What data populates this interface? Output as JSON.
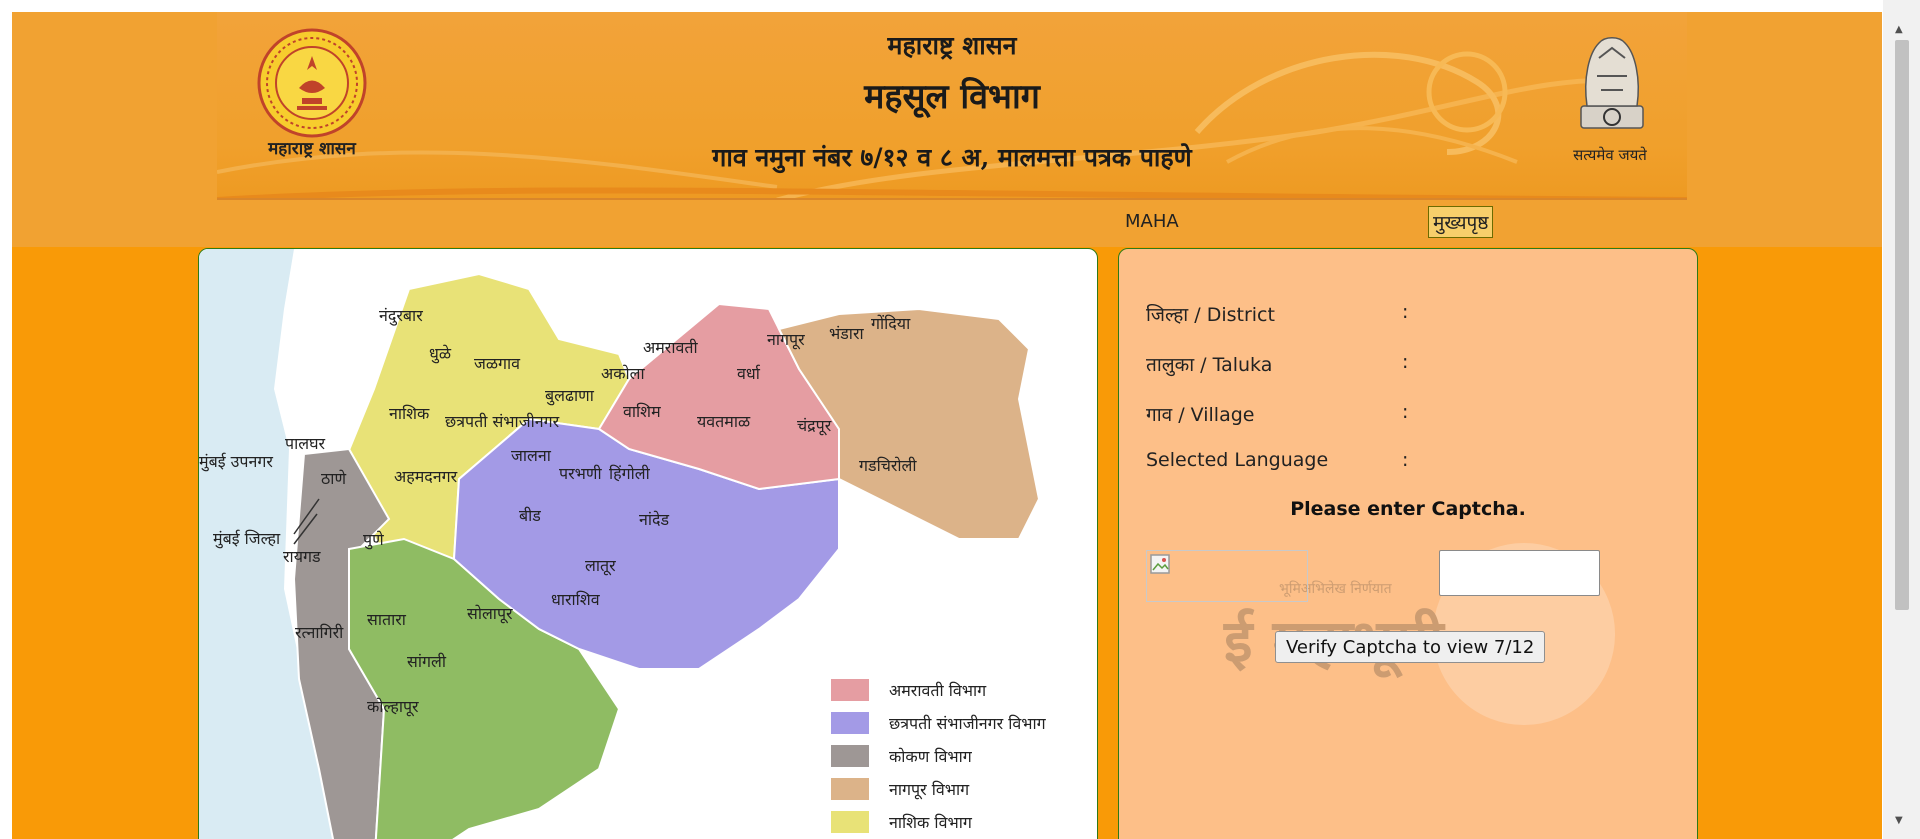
{
  "header": {
    "gov_title": "महाराष्ट्र शासन",
    "department_title": "महसूल विभाग",
    "subtitle": "गाव नमुना नंबर ७/१२ व ८ अ, मालमत्ता पत्रक पाहणे",
    "left_emblem_label": "महाराष्ट्र शासन",
    "right_emblem_label": "सत्यमेव जयते"
  },
  "nav": {
    "maha_link": "MAHA",
    "home_link": "मुख्यपृष्ठ"
  },
  "map": {
    "district_labels": [
      "नंदुरबार",
      "धुळे",
      "जळगाव",
      "नाशिक",
      "पालघर",
      "मुंबई उपनगर",
      "ठाणे",
      "मुंबई जिल्हा",
      "रायगड",
      "रत्नागिरी",
      "अहमदनगर",
      "पुणे",
      "सातारा",
      "सांगली",
      "कोल्हापूर",
      "सोलापूर",
      "छत्रपती संभाजीनगर",
      "जालना",
      "बीड",
      "परभणी",
      "हिंगोली",
      "नांदेड",
      "लातूर",
      "धाराशिव",
      "बुलढाणा",
      "अकोला",
      "अमरावती",
      "वाशिम",
      "यवतमाळ",
      "वर्धा",
      "नागपूर",
      "भंडारा",
      "गोंदिया",
      "चंद्रपूर",
      "गडचिरोली"
    ],
    "legend": [
      {
        "label": "अमरावती विभाग",
        "color": "#e59da2"
      },
      {
        "label": "छत्रपती संभाजीनगर विभाग",
        "color": "#a39ae6"
      },
      {
        "label": "कोकण विभाग",
        "color": "#9e9795"
      },
      {
        "label": "नागपूर विभाग",
        "color": "#dcb389"
      },
      {
        "label": "नाशिक विभाग",
        "color": "#e8e277"
      }
    ],
    "pune_division_color": "#8fbc63",
    "sea_color": "#d9ebf3"
  },
  "form": {
    "district_label": "जिल्हा / District",
    "taluka_label": "तालुका / Taluka",
    "village_label": "गाव / Village",
    "language_label": "Selected Language",
    "colon": ":",
    "captcha_prompt": "Please enter Captcha.",
    "captcha_input_value": "",
    "verify_button": "Verify Captcha to view 7/12",
    "watermark_small": "भूमिअभिलेख निर्णयात",
    "watermark_text": "ई महाभूमी"
  },
  "colors": {
    "page_background": "#f99a07",
    "header_background": "#f1a232",
    "form_panel": "#fdbf88",
    "panel_border": "#2f7a16"
  }
}
